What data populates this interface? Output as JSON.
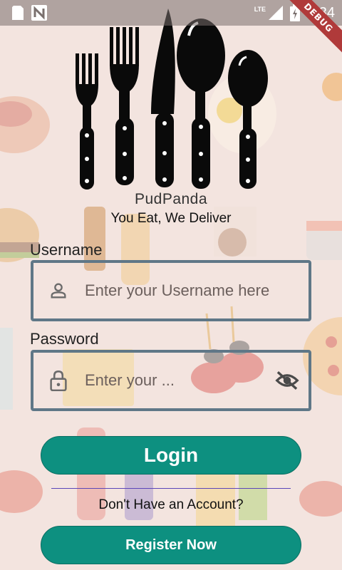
{
  "status_bar": {
    "time": "2:34",
    "network_label": "LTE",
    "debug_banner": "DEBUG"
  },
  "brand": {
    "name": "PudPanda",
    "tagline": "You Eat, We Deliver"
  },
  "form": {
    "username_label": "Username",
    "username_placeholder": "Enter your Username here",
    "password_label": "Password",
    "password_placeholder": "Enter your ..."
  },
  "actions": {
    "login_label": "Login",
    "no_account_text": "Don't Have an Account?",
    "register_label": "Register Now"
  },
  "colors": {
    "primary_button": "#0d9080",
    "field_border": "#5f7787",
    "divider": "#5b46b8",
    "background": "#f3e4df",
    "debug_ribbon": "#b03a3a"
  }
}
